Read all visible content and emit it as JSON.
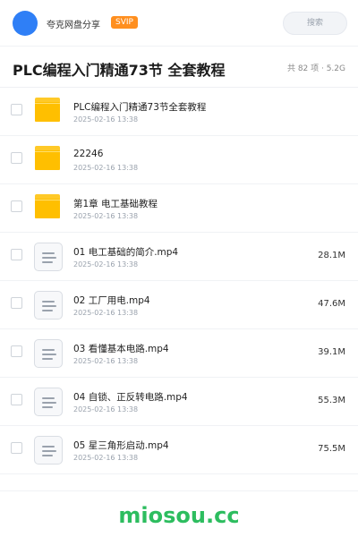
{
  "header": {
    "share_name": "夸克网盘分享",
    "badge": "SVIP",
    "search_label": "搜索"
  },
  "folder": {
    "title": "PLC编程入门精通73节 全套教程",
    "summary": "共 82 项 · 5.2G"
  },
  "items": [
    {
      "type": "folder",
      "name": "PLC编程入门精通73节全套教程",
      "date": "2025-02-16 13:38",
      "size": ""
    },
    {
      "type": "folder",
      "name": "22246",
      "date": "2025-02-16 13:38",
      "size": ""
    },
    {
      "type": "folder",
      "name": "第1章 电工基础教程",
      "date": "2025-02-16 13:38",
      "size": ""
    },
    {
      "type": "file",
      "name": "01 电工基础的简介.mp4",
      "date": "2025-02-16 13:38",
      "size": "28.1M"
    },
    {
      "type": "file",
      "name": "02 工厂用电.mp4",
      "date": "2025-02-16 13:38",
      "size": "47.6M"
    },
    {
      "type": "file",
      "name": "03 看懂基本电路.mp4",
      "date": "2025-02-16 13:38",
      "size": "39.1M"
    },
    {
      "type": "file",
      "name": "04 自锁、正反转电路.mp4",
      "date": "2025-02-16 13:38",
      "size": "55.3M"
    },
    {
      "type": "file",
      "name": "05 星三角形启动.mp4",
      "date": "2025-02-16 13:38",
      "size": "75.5M"
    }
  ],
  "footer": {
    "watermark": "miosou.cc"
  },
  "colors": {
    "avatar": "#2f7ff6",
    "badge": "#ff8f1f",
    "folder": "#ffbf00",
    "watermark": "#2dbd5f"
  }
}
